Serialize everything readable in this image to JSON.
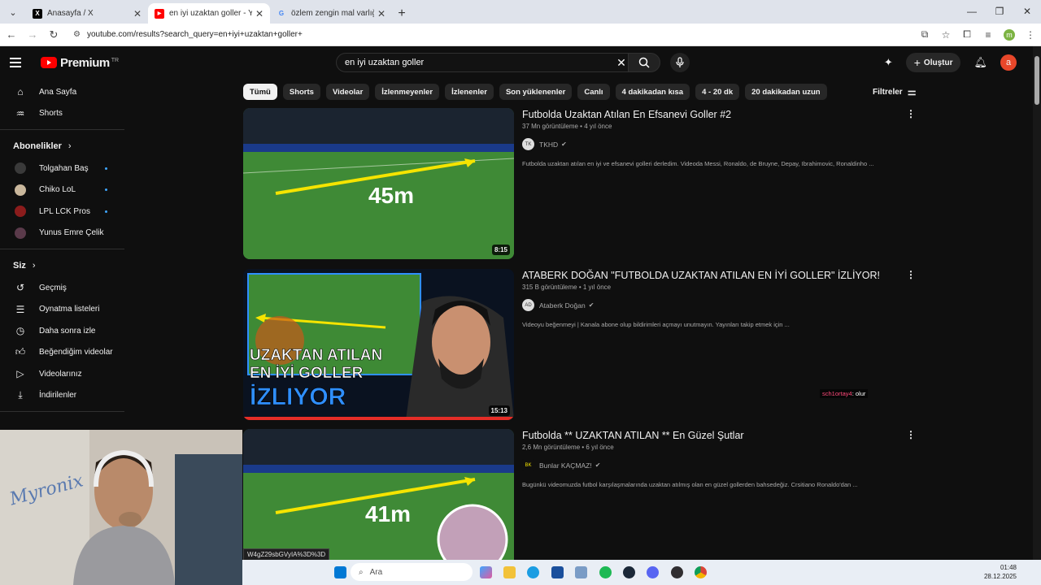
{
  "browser": {
    "tabs": [
      {
        "title": "Anasayfa / X",
        "icon": "x-logo-icon",
        "active": false
      },
      {
        "title": "en iyi uzaktan goller - YouTube",
        "icon": "youtube-icon",
        "active": true
      },
      {
        "title": "özlem zengin mal varlığı - Goo",
        "icon": "google-icon",
        "active": false
      }
    ],
    "url": "youtube.com/results?search_query=en+iyi+uzaktan+goller+"
  },
  "yt_header": {
    "logo_text": "Premium",
    "logo_sup": "TR",
    "search_value": "en iyi uzaktan goller",
    "create_label": "Oluştur",
    "avatar_letter": "a"
  },
  "sidebar": {
    "top": [
      {
        "label": "Ana Sayfa",
        "icon": "home-icon"
      },
      {
        "label": "Shorts",
        "icon": "shorts-icon"
      }
    ],
    "subs_heading": "Abonelikler",
    "subscriptions": [
      {
        "label": "Tolgahan Baş",
        "color": "#3a3a3a",
        "dot": true
      },
      {
        "label": "Chiko LoL",
        "color": "#c9b79c",
        "dot": true
      },
      {
        "label": "LPL LCK Pros",
        "color": "#8b1c1c",
        "dot": true
      },
      {
        "label": "Yunus Emre Çelik",
        "color": "#5a3a4a",
        "dot": false
      }
    ],
    "you_heading": "Siz",
    "you_items": [
      {
        "label": "Geçmiş",
        "icon": "history-icon"
      },
      {
        "label": "Oynatma listeleri",
        "icon": "playlists-icon"
      },
      {
        "label": "Daha sonra izle",
        "icon": "watch-later-icon"
      },
      {
        "label": "Beğendiğim videolar",
        "icon": "like-icon"
      },
      {
        "label": "Videolarınız",
        "icon": "your-videos-icon"
      },
      {
        "label": "İndirilenler",
        "icon": "downloads-icon"
      }
    ]
  },
  "chips": [
    "Tümü",
    "Shorts",
    "Videolar",
    "İzlenmeyenler",
    "İzlenenler",
    "Son yüklenenler",
    "Canlı",
    "4 dakikadan kısa",
    "4 - 20 dk",
    "20 dakikadan uzun"
  ],
  "filters_label": "Filtreler",
  "results": [
    {
      "title": "Futbolda Uzaktan Atılan En Efsanevi Goller #2",
      "views": "37 Mn görüntüleme",
      "age": "4 yıl önce",
      "channel": "TKHD",
      "channel_avatar": "TK",
      "description": "Futbolda uzaktan atılan en iyi ve efsanevi golleri derledim. Videoda Messi, Ronaldo, de Bruyne, Depay, Ibrahimovic, Ronaldinho ...",
      "duration": "8:15",
      "thumb_text": "45m"
    },
    {
      "title": "ATABERK DOĞAN \"FUTBOLDA UZAKTAN ATILAN EN İYİ GOLLER\" İZLİYOR!",
      "views": "315 B görüntüleme",
      "age": "1 yıl önce",
      "channel": "Ataberk Doğan",
      "channel_avatar": "AD",
      "description": "Videoyu beğenmeyi | Kanala abone olup bildirimleri açmayı unutmayın. Yayınları takip etmek için ...",
      "duration": "15:13",
      "thumb_lines": [
        "UZAKTAN ATILAN",
        "EN İYİ GOLLER",
        "İZLIYOR"
      ]
    },
    {
      "title": "Futbolda ** UZAKTAN ATILAN ** En Güzel Şutlar",
      "views": "2,6 Mn görüntüleme",
      "age": "6 yıl önce",
      "channel": "Bunlar KAÇMAZ!",
      "channel_avatar": "BK",
      "description": "Bugünkü videomuzda futbol karşılaşmalarında uzaktan atılmış olan en güzel gollerden bahsedeğiz. Crsitiano Ronaldo'dan ...",
      "thumb_text": "41m"
    }
  ],
  "overlay": {
    "chat_user": "sch1ortay4",
    "chat_msg": ": olur",
    "status_url": "W4gZ29sbGVyIA%3D%3D",
    "webcam_text": "Myronix"
  },
  "taskbar": {
    "search_placeholder": "Ara",
    "time": "01:48",
    "date": "28.12.2025"
  }
}
